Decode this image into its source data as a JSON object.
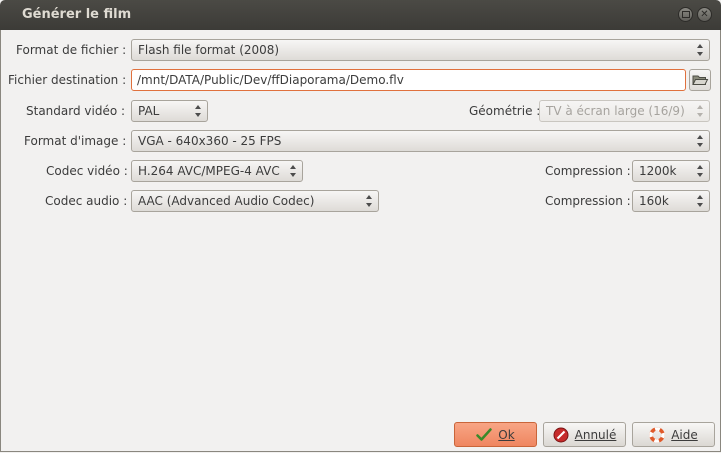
{
  "window": {
    "title": "Générer le film"
  },
  "form": {
    "format_label": "Format de fichier :",
    "format_value": "Flash file format (2008)",
    "dest_label": "Fichier destination :",
    "dest_value": "/mnt/DATA/Public/Dev/ffDiaporama/Demo.flv",
    "standard_label": "Standard vidéo :",
    "standard_value": "PAL",
    "geometry_label": "Géométrie :",
    "geometry_value": "TV à écran large (16/9)",
    "image_format_label": "Format d'image :",
    "image_format_value": "VGA - 640x360 - 25 FPS",
    "video_codec_label": "Codec vidéo :",
    "video_codec_value": "H.264 AVC/MPEG-4 AVC",
    "video_compression_label": "Compression :",
    "video_compression_value": "1200k",
    "audio_codec_label": "Codec audio :",
    "audio_codec_value": "AAC (Advanced Audio Codec)",
    "audio_compression_label": "Compression :",
    "audio_compression_value": "160k"
  },
  "buttons": {
    "ok_label": "Ok",
    "cancel_label": "Annulé",
    "help_label": "Aide"
  },
  "colors": {
    "title_bar": "#3c3b37",
    "focus_border": "#e0713d",
    "default_button": "#ef8660"
  }
}
